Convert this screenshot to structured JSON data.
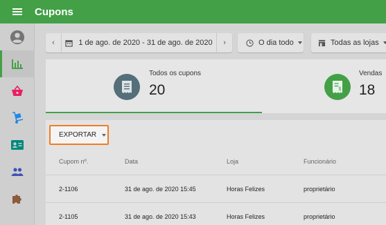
{
  "header": {
    "title": "Cupons",
    "menu_icon": "hamburger-menu-icon",
    "color": "#43a047"
  },
  "sidebar": {
    "items": [
      {
        "name": "account",
        "icon": "user-avatar-icon",
        "color": "#757575"
      },
      {
        "name": "reports",
        "icon": "bar-chart-icon",
        "color": "#43a047",
        "active": true
      },
      {
        "name": "sales",
        "icon": "basket-icon",
        "color": "#e91e63"
      },
      {
        "name": "inventory",
        "icon": "hand-truck-icon",
        "color": "#1e88e5"
      },
      {
        "name": "employees",
        "icon": "id-card-icon",
        "color": "#00897b"
      },
      {
        "name": "customers",
        "icon": "people-icon",
        "color": "#3f51b5"
      },
      {
        "name": "integrations",
        "icon": "puzzle-piece-icon",
        "color": "#8d5a3b"
      }
    ]
  },
  "filters": {
    "date_range": "1 de ago. de 2020 - 31 de ago. de 2020",
    "time": "O dia todo",
    "stores": "Todas as lojas"
  },
  "stats": [
    {
      "label": "Todos os cupons",
      "value": "20",
      "icon": "receipt-icon",
      "color": "#546e7a"
    },
    {
      "label": "Vendas",
      "value": "18",
      "icon": "receipt-money-icon",
      "color": "#43a047"
    }
  ],
  "table": {
    "export_label": "EXPORTAR",
    "headers": [
      "Cupom nº.",
      "Data",
      "Loja",
      "Funcionário"
    ],
    "rows": [
      [
        "2-1106",
        "31 de ago. de 2020 15:45",
        "Horas Felizes",
        "proprietário"
      ],
      [
        "2-1105",
        "31 de ago. de 2020 15:43",
        "Horas Felizes",
        "proprietário"
      ]
    ]
  }
}
